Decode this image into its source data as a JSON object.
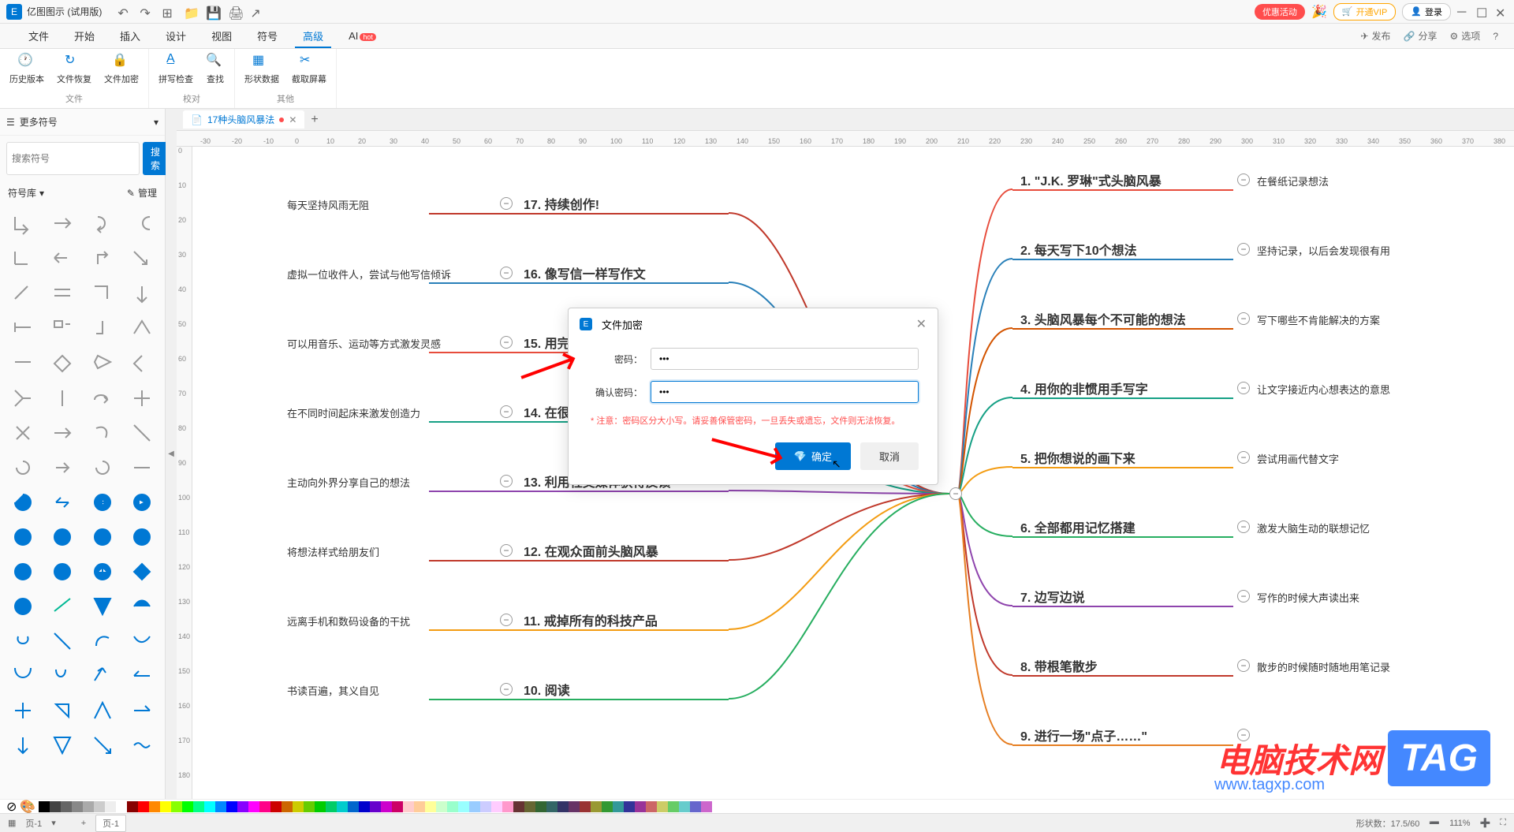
{
  "app": {
    "title": "亿图图示 (试用版)"
  },
  "titlebar": {
    "promo": "优惠活动",
    "vip": "开通VIP",
    "login": "登录"
  },
  "menu": {
    "items": [
      "文件",
      "开始",
      "插入",
      "设计",
      "视图",
      "符号",
      "高级",
      "AI"
    ],
    "active": "高级",
    "hot": "hot",
    "right": {
      "publish": "发布",
      "share": "分享",
      "options": "选项"
    }
  },
  "ribbon": {
    "groups": [
      {
        "label": "文件",
        "items": [
          "历史版本",
          "文件恢复",
          "文件加密"
        ]
      },
      {
        "label": "校对",
        "items": [
          "拼写检查",
          "查找"
        ]
      },
      {
        "label": "其他",
        "items": [
          "形状数据",
          "截取屏幕"
        ]
      }
    ]
  },
  "sidebar": {
    "header": "更多符号",
    "search_placeholder": "搜索符号",
    "search_btn": "搜索",
    "tab_lib": "符号库",
    "tab_manage": "管理"
  },
  "doc": {
    "tab_title": "17种头脑风暴法",
    "page_tab": "页-1"
  },
  "mindmap": {
    "left": [
      {
        "num": "17.",
        "title": "持续创作!",
        "sub": "每天坚持风雨无阻"
      },
      {
        "num": "16.",
        "title": "像写信一样写作文",
        "sub": "虚拟一位收件人，尝试与他写信倾诉"
      },
      {
        "num": "15.",
        "title": "用完全……",
        "sub": "可以用音乐、运动等方式激发灵感"
      },
      {
        "num": "14.",
        "title": "在很……",
        "sub": "在不同时间起床来激发创造力"
      },
      {
        "num": "13.",
        "title": "利用社交媒体获得反馈",
        "sub": "主动向外界分享自己的想法"
      },
      {
        "num": "12.",
        "title": "在观众面前头脑风暴",
        "sub": "将想法样式给朋友们"
      },
      {
        "num": "11.",
        "title": "戒掉所有的科技产品",
        "sub": "远离手机和数码设备的干扰"
      },
      {
        "num": "10.",
        "title": "阅读",
        "sub": "书读百遍，其义自见"
      }
    ],
    "right": [
      {
        "num": "1.",
        "title": "\"J.K. 罗琳\"式头脑风暴",
        "sub": "在餐纸记录想法"
      },
      {
        "num": "2.",
        "title": "每天写下10个想法",
        "sub": "坚持记录，以后会发现很有用"
      },
      {
        "num": "3.",
        "title": "头脑风暴每个不可能的想法",
        "sub": "写下哪些不肯能解决的方案"
      },
      {
        "num": "4.",
        "title": "用你的非惯用手写字",
        "sub": "让文字接近内心想表达的意思"
      },
      {
        "num": "5.",
        "title": "把你想说的画下来",
        "sub": "尝试用画代替文字"
      },
      {
        "num": "6.",
        "title": "全部都用记忆搭建",
        "sub": "激发大脑生动的联想记忆"
      },
      {
        "num": "7.",
        "title": "边写边说",
        "sub": "写作的时候大声读出来"
      },
      {
        "num": "8.",
        "title": "带根笔散步",
        "sub": "散步的时候随时随地用笔记录"
      },
      {
        "num": "9.",
        "title": "进行一场\"点子……\"",
        "sub": ""
      }
    ]
  },
  "dialog": {
    "title": "文件加密",
    "password_label": "密码：",
    "confirm_label": "确认密码：",
    "password_value": "•••",
    "confirm_value": "•••",
    "note": "* 注意：密码区分大小写。请妥善保管密码，一旦丢失或遗忘，文件则无法恢复。",
    "ok": "确定",
    "cancel": "取消"
  },
  "statusbar": {
    "page": "页-1",
    "shapes": "形状数：17.5/60",
    "zoom": "111%"
  },
  "watermark": {
    "text": "电脑技术网",
    "url": "www.tagxp.com",
    "tag": "TAG"
  },
  "ruler_h": [
    -30,
    -20,
    -10,
    0,
    10,
    20,
    30,
    40,
    50,
    60,
    70,
    80,
    90,
    100,
    110,
    120,
    130,
    140,
    150,
    160,
    170,
    180,
    190,
    200,
    210,
    220,
    230,
    240,
    250,
    260,
    270,
    280,
    290,
    300,
    310,
    320,
    330,
    340,
    350,
    360,
    370,
    380
  ],
  "ruler_v": [
    0,
    10,
    20,
    30,
    40,
    50,
    60,
    70,
    80,
    90,
    100,
    110,
    120,
    130,
    140,
    150,
    160,
    170,
    180
  ],
  "colors": [
    "#000",
    "#444",
    "#666",
    "#888",
    "#aaa",
    "#ccc",
    "#eee",
    "#fff",
    "#800",
    "#f00",
    "#f80",
    "#ff0",
    "#8f0",
    "#0f0",
    "#0f8",
    "#0ff",
    "#08f",
    "#00f",
    "#80f",
    "#f0f",
    "#f08",
    "#c00",
    "#c60",
    "#cc0",
    "#6c0",
    "#0c0",
    "#0c6",
    "#0cc",
    "#06c",
    "#00c",
    "#60c",
    "#c0c",
    "#c06",
    "#fcc",
    "#fc9",
    "#ff9",
    "#cfc",
    "#9fc",
    "#9ff",
    "#9cf",
    "#ccf",
    "#fcf",
    "#f9c",
    "#633",
    "#663",
    "#363",
    "#366",
    "#336",
    "#636",
    "#933",
    "#993",
    "#393",
    "#399",
    "#339",
    "#939",
    "#c66",
    "#cc6",
    "#6c6",
    "#6cc",
    "#66c",
    "#c6c"
  ]
}
